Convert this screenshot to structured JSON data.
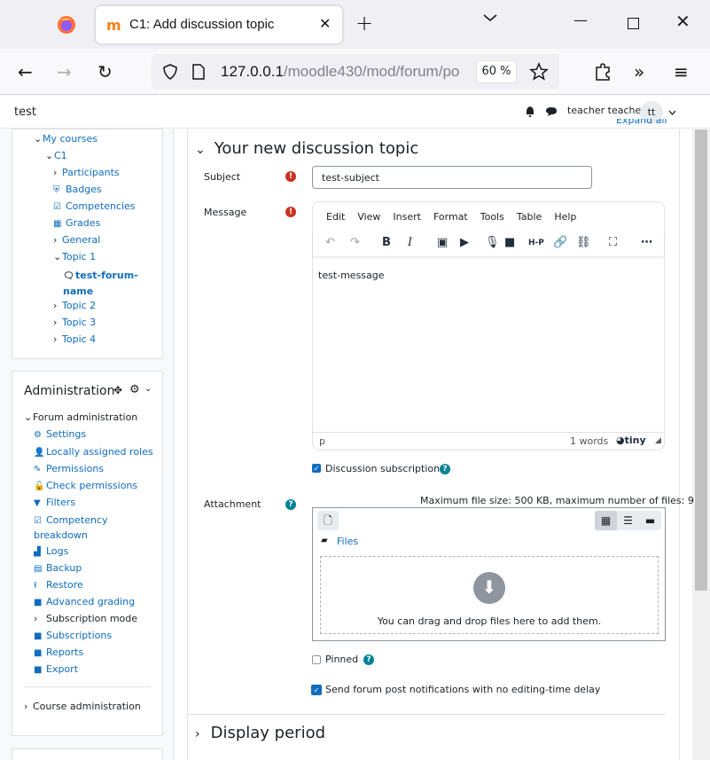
{
  "browser": {
    "tab_title": "C1: Add discussion topic",
    "new_tab_glyph": "+",
    "url_host": "127.0.0.1",
    "url_path": "/moodle430/mod/forum/po",
    "zoom": "60 %"
  },
  "header": {
    "site_name": "test",
    "user_name": "teacher teacher",
    "avatar_initials": "tt"
  },
  "drawer": {
    "course_nav": {
      "my_courses": "My courses",
      "course": "C1",
      "items": [
        {
          "label": "Participants",
          "icon": "chevron-right-icon"
        },
        {
          "label": "Badges",
          "icon": "shield-icon"
        },
        {
          "label": "Competencies",
          "icon": "checkbox-icon"
        },
        {
          "label": "Grades",
          "icon": "table-icon"
        },
        {
          "label": "General",
          "icon": "chevron-right-icon"
        },
        {
          "label": "Topic 1",
          "icon": "chevron-down-icon"
        },
        {
          "label": "test-forum-name",
          "icon": "forum-icon"
        },
        {
          "label": "Topic 2",
          "icon": "chevron-right-icon"
        },
        {
          "label": "Topic 3",
          "icon": "chevron-right-icon"
        },
        {
          "label": "Topic 4",
          "icon": "chevron-right-icon"
        }
      ]
    },
    "administration": {
      "title": "Administration",
      "forum_admin": "Forum administration",
      "items": [
        {
          "label": "Settings",
          "icon": "gear-icon"
        },
        {
          "label": "Locally assigned roles",
          "icon": "user-icon"
        },
        {
          "label": "Permissions",
          "icon": "edit-icon"
        },
        {
          "label": "Check permissions",
          "icon": "unlock-icon"
        },
        {
          "label": "Filters",
          "icon": "filter-icon"
        },
        {
          "label": "Competency breakdown",
          "icon": "checkbox-icon"
        },
        {
          "label": "Logs",
          "icon": "chart-icon"
        },
        {
          "label": "Backup",
          "icon": "file-icon"
        },
        {
          "label": "Restore",
          "icon": "upload-icon"
        },
        {
          "label": "Advanced grading",
          "icon": "square-icon"
        },
        {
          "label": "Subscription mode",
          "icon": "chevron-right-icon"
        },
        {
          "label": "Subscriptions",
          "icon": "square-icon"
        },
        {
          "label": "Reports",
          "icon": "square-icon"
        },
        {
          "label": "Export",
          "icon": "square-icon"
        }
      ],
      "course_admin": "Course administration"
    }
  },
  "form": {
    "expand_all": "Expand all",
    "section_title": "Your new discussion topic",
    "subject_label": "Subject",
    "subject_value": "test-subject",
    "message_label": "Message",
    "editor_menu": [
      "Edit",
      "View",
      "Insert",
      "Format",
      "Tools",
      "Table",
      "Help"
    ],
    "message_value": "test-message",
    "editor_path": "p",
    "word_count": "1 words",
    "editor_brand": "tiny",
    "discussion_subscription": "Discussion subscription",
    "attachment_label": "Attachment",
    "max_size": "Maximum file size: 500 KB, maximum number of files: 9",
    "files_label": "Files",
    "drop_text": "You can drag and drop files here to add them.",
    "pinned": "Pinned",
    "send_now": "Send forum post notifications with no editing-time delay",
    "display_period": "Display period"
  }
}
